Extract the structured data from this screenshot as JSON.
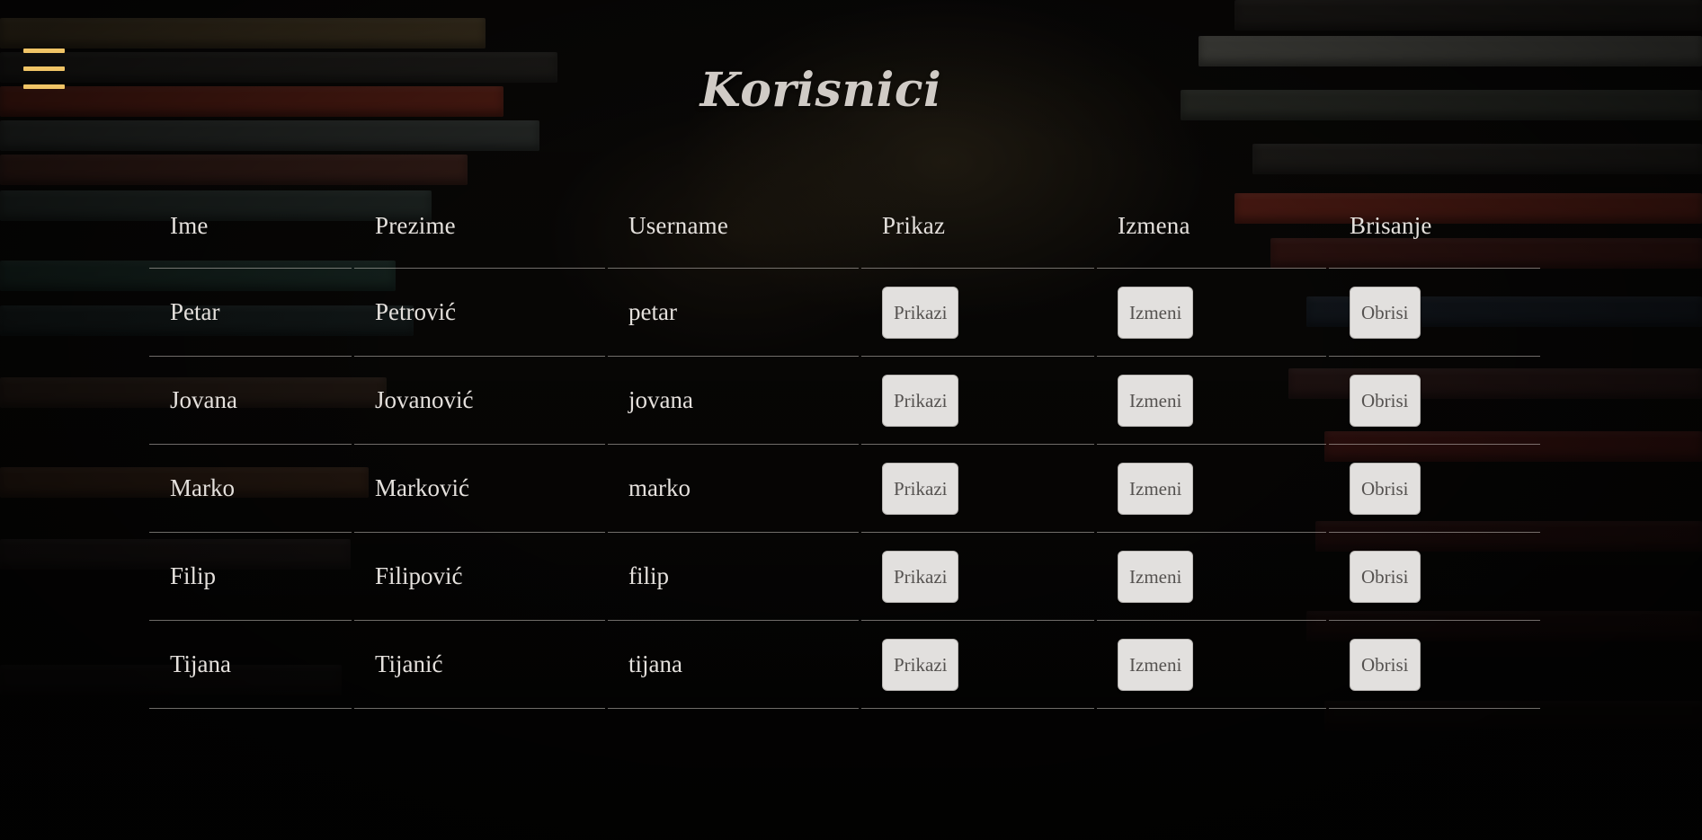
{
  "page": {
    "title": "Korisnici",
    "menu_icon": "hamburger-menu-icon",
    "accent_color": "#f0c466"
  },
  "table": {
    "headers": [
      "Ime",
      "Prezime",
      "Username",
      "Prikaz",
      "Izmena",
      "Brisanje"
    ],
    "rows": [
      {
        "ime": "Petar",
        "prezime": "Petrović",
        "username": "petar",
        "view": "Prikazi",
        "edit": "Izmeni",
        "delete": "Obrisi"
      },
      {
        "ime": "Jovana",
        "prezime": "Jovanović",
        "username": "jovana",
        "view": "Prikazi",
        "edit": "Izmeni",
        "delete": "Obrisi"
      },
      {
        "ime": "Marko",
        "prezime": "Marković",
        "username": "marko",
        "view": "Prikazi",
        "edit": "Izmeni",
        "delete": "Obrisi"
      },
      {
        "ime": "Filip",
        "prezime": "Filipović",
        "username": "filip",
        "view": "Prikazi",
        "edit": "Izmeni",
        "delete": "Obrisi"
      },
      {
        "ime": "Tijana",
        "prezime": "Tijanić",
        "username": "tijana",
        "view": "Prikazi",
        "edit": "Izmeni",
        "delete": "Obrisi"
      }
    ]
  }
}
